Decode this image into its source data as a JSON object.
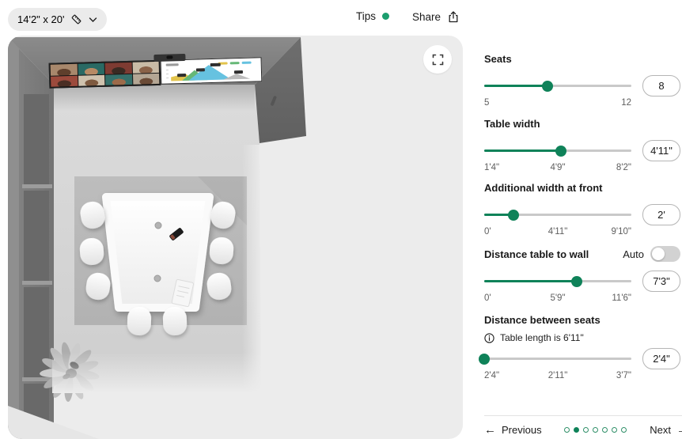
{
  "header": {
    "room_size": "14'2\" x 20'",
    "tips": "Tips",
    "share": "Share"
  },
  "icons": {
    "room_size_icon": "ruler-icon",
    "room_size_chevron": "chevron-down-icon",
    "tips_status": "green-dot",
    "share_icon": "share-icon",
    "fullscreen": "fullscreen-icon",
    "info": "info-icon"
  },
  "colors": {
    "accent": "#0f8259",
    "tips_dot": "#1b9e6e",
    "dot_outline": "#2f8f68"
  },
  "room": {
    "screen_tiles": [
      {
        "bg": "#a8886c",
        "fg": "#5f3f2c"
      },
      {
        "bg": "#2a6a64",
        "fg": "#b78a64"
      },
      {
        "bg": "#7e3b32",
        "fg": "#3a2a22"
      },
      {
        "bg": "#c9bba6",
        "fg": "#8a6248"
      },
      {
        "bg": "#9c4a3c",
        "fg": "#4a2e24"
      },
      {
        "bg": "#cfc2ae",
        "fg": "#7e5a40"
      },
      {
        "bg": "#35706a",
        "fg": "#9c6a4a"
      },
      {
        "bg": "#b4a694",
        "fg": "#6a4a36"
      }
    ],
    "chart_colors": {
      "yellow": "#e3c44c",
      "green": "#66b877",
      "blue": "#66c2e0",
      "gray": "#bcbcbc"
    }
  },
  "controls": {
    "sliders": [
      {
        "label": "Seats",
        "min": "5",
        "mid": "",
        "max": "12",
        "value": "8",
        "percent": 43
      },
      {
        "label": "Table width",
        "min": "1'4\"",
        "mid": "4'9\"",
        "max": "8'2\"",
        "value": "4'11\"",
        "percent": 52
      },
      {
        "label": "Additional width at front",
        "min": "0'",
        "mid": "4'11\"",
        "max": "9'10\"",
        "value": "2'",
        "percent": 20
      },
      {
        "label": "Distance table to wall",
        "min": "0'",
        "mid": "5'9\"",
        "max": "11'6\"",
        "value": "7'3\"",
        "percent": 63
      },
      {
        "label": "Distance between seats",
        "min": "2'4\"",
        "mid": "2'11\"",
        "max": "3'7\"",
        "value": "2'4\"",
        "percent": 0
      }
    ],
    "auto": {
      "label": "Auto",
      "on": false
    },
    "info_note": "Table length is 6'11\"",
    "pagination": {
      "previous": "Previous",
      "next": "Next",
      "dots": 7,
      "active": 2
    }
  }
}
